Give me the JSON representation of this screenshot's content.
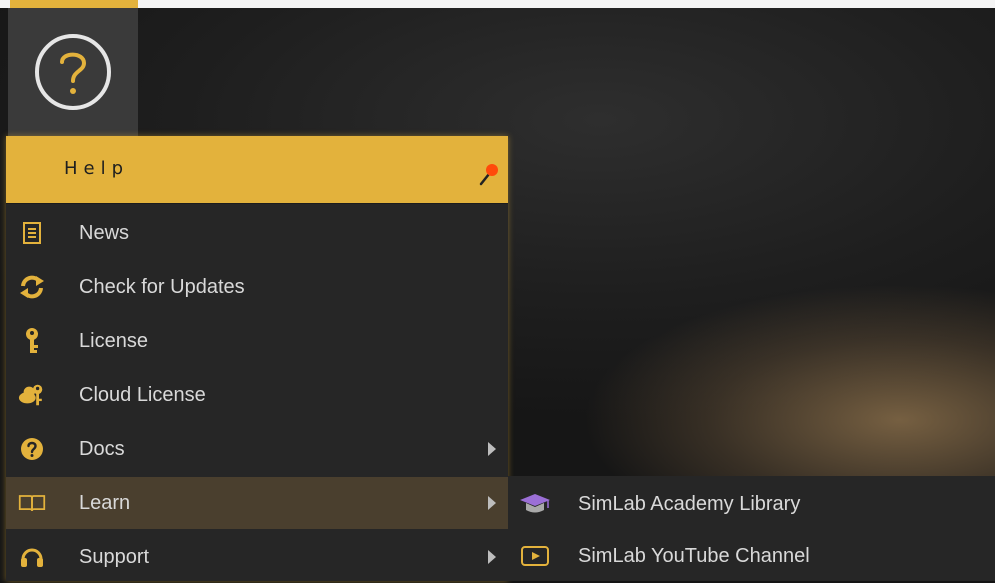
{
  "help_tile": {
    "icon": "question-circle-icon"
  },
  "menu": {
    "title": "Help",
    "items": [
      {
        "label": "News",
        "icon": "news-document-icon",
        "has_submenu": false
      },
      {
        "label": "Check for Updates",
        "icon": "refresh-icon",
        "has_submenu": false
      },
      {
        "label": "License",
        "icon": "key-icon",
        "has_submenu": false
      },
      {
        "label": "Cloud License",
        "icon": "cloud-key-icon",
        "has_submenu": false
      },
      {
        "label": "Docs",
        "icon": "help-icon",
        "has_submenu": true
      },
      {
        "label": "Learn",
        "icon": "book-icon",
        "has_submenu": true,
        "active": true
      },
      {
        "label": "Support",
        "icon": "headset-icon",
        "has_submenu": true
      }
    ]
  },
  "learn_submenu": {
    "items": [
      {
        "label": "SimLab Academy Library",
        "icon": "graduation-cap-icon"
      },
      {
        "label": "SimLab YouTube Channel",
        "icon": "play-button-icon"
      }
    ]
  },
  "colors": {
    "accent": "#e3b23c",
    "menu_bg": "#262626",
    "active_bg": "#4a3f2e",
    "text": "#d9d9d9"
  }
}
